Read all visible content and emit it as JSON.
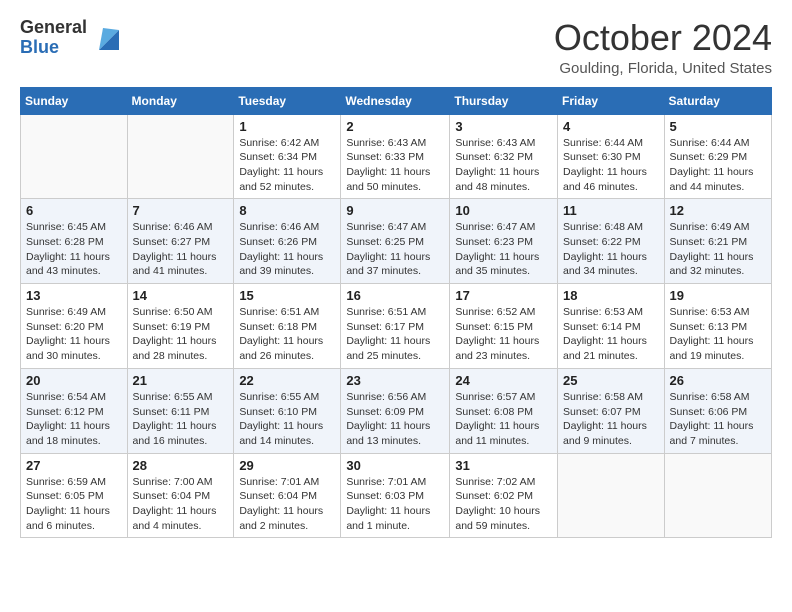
{
  "logo": {
    "general": "General",
    "blue": "Blue"
  },
  "title": {
    "month": "October 2024",
    "location": "Goulding, Florida, United States"
  },
  "weekdays": [
    "Sunday",
    "Monday",
    "Tuesday",
    "Wednesday",
    "Thursday",
    "Friday",
    "Saturday"
  ],
  "weeks": [
    [
      {
        "day": "",
        "info": ""
      },
      {
        "day": "",
        "info": ""
      },
      {
        "day": "1",
        "info": "Sunrise: 6:42 AM\nSunset: 6:34 PM\nDaylight: 11 hours and 52 minutes."
      },
      {
        "day": "2",
        "info": "Sunrise: 6:43 AM\nSunset: 6:33 PM\nDaylight: 11 hours and 50 minutes."
      },
      {
        "day": "3",
        "info": "Sunrise: 6:43 AM\nSunset: 6:32 PM\nDaylight: 11 hours and 48 minutes."
      },
      {
        "day": "4",
        "info": "Sunrise: 6:44 AM\nSunset: 6:30 PM\nDaylight: 11 hours and 46 minutes."
      },
      {
        "day": "5",
        "info": "Sunrise: 6:44 AM\nSunset: 6:29 PM\nDaylight: 11 hours and 44 minutes."
      }
    ],
    [
      {
        "day": "6",
        "info": "Sunrise: 6:45 AM\nSunset: 6:28 PM\nDaylight: 11 hours and 43 minutes."
      },
      {
        "day": "7",
        "info": "Sunrise: 6:46 AM\nSunset: 6:27 PM\nDaylight: 11 hours and 41 minutes."
      },
      {
        "day": "8",
        "info": "Sunrise: 6:46 AM\nSunset: 6:26 PM\nDaylight: 11 hours and 39 minutes."
      },
      {
        "day": "9",
        "info": "Sunrise: 6:47 AM\nSunset: 6:25 PM\nDaylight: 11 hours and 37 minutes."
      },
      {
        "day": "10",
        "info": "Sunrise: 6:47 AM\nSunset: 6:23 PM\nDaylight: 11 hours and 35 minutes."
      },
      {
        "day": "11",
        "info": "Sunrise: 6:48 AM\nSunset: 6:22 PM\nDaylight: 11 hours and 34 minutes."
      },
      {
        "day": "12",
        "info": "Sunrise: 6:49 AM\nSunset: 6:21 PM\nDaylight: 11 hours and 32 minutes."
      }
    ],
    [
      {
        "day": "13",
        "info": "Sunrise: 6:49 AM\nSunset: 6:20 PM\nDaylight: 11 hours and 30 minutes."
      },
      {
        "day": "14",
        "info": "Sunrise: 6:50 AM\nSunset: 6:19 PM\nDaylight: 11 hours and 28 minutes."
      },
      {
        "day": "15",
        "info": "Sunrise: 6:51 AM\nSunset: 6:18 PM\nDaylight: 11 hours and 26 minutes."
      },
      {
        "day": "16",
        "info": "Sunrise: 6:51 AM\nSunset: 6:17 PM\nDaylight: 11 hours and 25 minutes."
      },
      {
        "day": "17",
        "info": "Sunrise: 6:52 AM\nSunset: 6:15 PM\nDaylight: 11 hours and 23 minutes."
      },
      {
        "day": "18",
        "info": "Sunrise: 6:53 AM\nSunset: 6:14 PM\nDaylight: 11 hours and 21 minutes."
      },
      {
        "day": "19",
        "info": "Sunrise: 6:53 AM\nSunset: 6:13 PM\nDaylight: 11 hours and 19 minutes."
      }
    ],
    [
      {
        "day": "20",
        "info": "Sunrise: 6:54 AM\nSunset: 6:12 PM\nDaylight: 11 hours and 18 minutes."
      },
      {
        "day": "21",
        "info": "Sunrise: 6:55 AM\nSunset: 6:11 PM\nDaylight: 11 hours and 16 minutes."
      },
      {
        "day": "22",
        "info": "Sunrise: 6:55 AM\nSunset: 6:10 PM\nDaylight: 11 hours and 14 minutes."
      },
      {
        "day": "23",
        "info": "Sunrise: 6:56 AM\nSunset: 6:09 PM\nDaylight: 11 hours and 13 minutes."
      },
      {
        "day": "24",
        "info": "Sunrise: 6:57 AM\nSunset: 6:08 PM\nDaylight: 11 hours and 11 minutes."
      },
      {
        "day": "25",
        "info": "Sunrise: 6:58 AM\nSunset: 6:07 PM\nDaylight: 11 hours and 9 minutes."
      },
      {
        "day": "26",
        "info": "Sunrise: 6:58 AM\nSunset: 6:06 PM\nDaylight: 11 hours and 7 minutes."
      }
    ],
    [
      {
        "day": "27",
        "info": "Sunrise: 6:59 AM\nSunset: 6:05 PM\nDaylight: 11 hours and 6 minutes."
      },
      {
        "day": "28",
        "info": "Sunrise: 7:00 AM\nSunset: 6:04 PM\nDaylight: 11 hours and 4 minutes."
      },
      {
        "day": "29",
        "info": "Sunrise: 7:01 AM\nSunset: 6:04 PM\nDaylight: 11 hours and 2 minutes."
      },
      {
        "day": "30",
        "info": "Sunrise: 7:01 AM\nSunset: 6:03 PM\nDaylight: 11 hours and 1 minute."
      },
      {
        "day": "31",
        "info": "Sunrise: 7:02 AM\nSunset: 6:02 PM\nDaylight: 10 hours and 59 minutes."
      },
      {
        "day": "",
        "info": ""
      },
      {
        "day": "",
        "info": ""
      }
    ]
  ]
}
